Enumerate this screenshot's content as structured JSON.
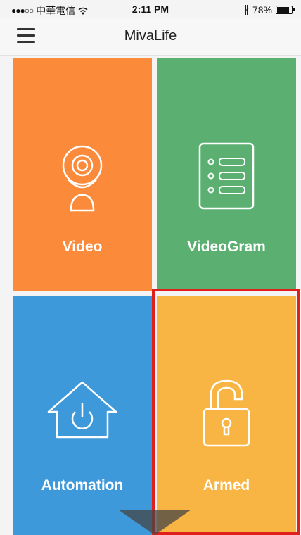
{
  "status_bar": {
    "carrier": "中華電信",
    "time": "2:11 PM",
    "battery": "78%"
  },
  "nav": {
    "title": "MivaLife",
    "menu_icon": "hamburger-menu-icon"
  },
  "tiles": [
    {
      "label": "Video",
      "icon": "webcam-icon",
      "color": "#fc8a3b"
    },
    {
      "label": "VideoGram",
      "icon": "list-icon",
      "color": "#5bb071"
    },
    {
      "label": "Automation",
      "icon": "home-power-icon",
      "color": "#3e99db"
    },
    {
      "label": "Armed",
      "icon": "padlock-icon",
      "color": "#f9b543",
      "highlighted": true
    }
  ],
  "highlight_color": "#e0201c"
}
